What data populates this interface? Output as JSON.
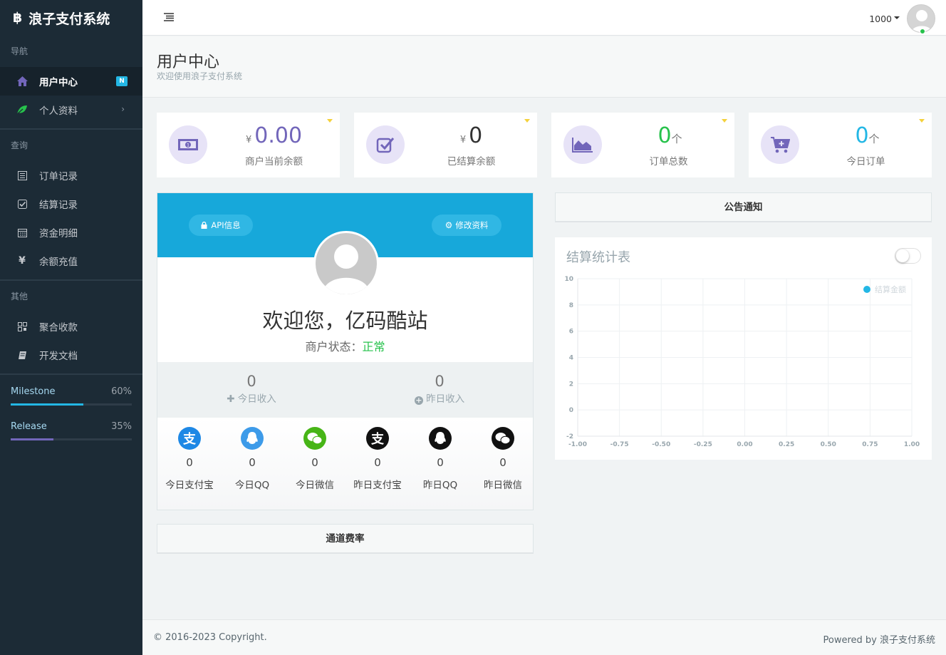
{
  "brand": {
    "title": "浪子支付系统"
  },
  "sidebar": {
    "sections": [
      {
        "heading": "导航",
        "items": [
          {
            "label": "用户中心",
            "badge": "N",
            "active": true
          },
          {
            "label": "个人资料",
            "chevron": "›"
          }
        ]
      },
      {
        "heading": "查询",
        "items": [
          {
            "label": "订单记录"
          },
          {
            "label": "结算记录"
          },
          {
            "label": "资金明细"
          },
          {
            "label": "余额充值"
          }
        ]
      },
      {
        "heading": "其他",
        "items": [
          {
            "label": "聚合收款"
          },
          {
            "label": "开发文档"
          }
        ]
      }
    ],
    "progress": [
      {
        "label": "Milestone",
        "percent_text": "60%",
        "value": 0.6,
        "color": "#23b7e5"
      },
      {
        "label": "Release",
        "percent_text": "35%",
        "value": 0.35,
        "color": "#7266ba"
      }
    ]
  },
  "header": {
    "username": "1000"
  },
  "page": {
    "title": "用户中心",
    "subtitle": "欢迎使用浪子支付系统"
  },
  "stats": [
    {
      "currency": "¥",
      "value": "0.00",
      "unit": "",
      "label": "商户当前余额",
      "color": "#7266ba",
      "icon": "money-icon"
    },
    {
      "currency": "¥",
      "value": "0",
      "unit": "",
      "label": "已结算余额",
      "color": "#333333",
      "icon": "checkbox-icon"
    },
    {
      "currency": "",
      "value": "0",
      "unit": "个",
      "label": "订单总数",
      "color": "#27c24c",
      "icon": "area-chart-icon"
    },
    {
      "currency": "",
      "value": "0",
      "unit": "个",
      "label": "今日订单",
      "color": "#23b7e5",
      "icon": "cart-icon"
    }
  ],
  "profile": {
    "api_button": "API信息",
    "edit_button": "修改资料",
    "welcome": "欢迎您，亿码酷站",
    "status_label": "商户状态：",
    "status_value": "正常",
    "income": [
      {
        "value": "0",
        "label": "今日收入",
        "icon": "plus-icon"
      },
      {
        "value": "0",
        "label": "昨日收入",
        "icon": "plus-circle-icon"
      }
    ],
    "payments": [
      {
        "value": "0",
        "label": "今日支付宝",
        "icon": "alipay-icon",
        "color": "#1e88e5"
      },
      {
        "value": "0",
        "label": "今日QQ",
        "icon": "qq-icon",
        "color": "#3d9be9"
      },
      {
        "value": "0",
        "label": "今日微信",
        "icon": "wechat-icon",
        "color": "#47b517"
      },
      {
        "value": "0",
        "label": "昨日支付宝",
        "icon": "alipay-icon",
        "color": "#111111"
      },
      {
        "value": "0",
        "label": "昨日QQ",
        "icon": "qq-icon",
        "color": "#111111"
      },
      {
        "value": "0",
        "label": "昨日微信",
        "icon": "wechat-icon",
        "color": "#111111"
      }
    ]
  },
  "panels": {
    "rate": "通道费率",
    "notice": "公告通知"
  },
  "chart_data": {
    "type": "line",
    "title": "结算统计表",
    "legend": [
      "结算金额"
    ],
    "legend_position": "top-right",
    "series": [
      {
        "name": "结算金额",
        "values": [],
        "color": "#23b7e5"
      }
    ],
    "xlim": [
      -1,
      1
    ],
    "ylim": [
      -2,
      10
    ],
    "x_ticks": [
      "-1.00",
      "-0.75",
      "-0.50",
      "-0.25",
      "0.00",
      "0.25",
      "0.50",
      "0.75",
      "1.00"
    ],
    "y_ticks": [
      "10",
      "8",
      "6",
      "4",
      "2",
      "0",
      "-2"
    ],
    "grid": true
  },
  "footer": {
    "copyright": "© 2016-2023 Copyright.",
    "powered": "Powered by 浪子支付系统"
  }
}
